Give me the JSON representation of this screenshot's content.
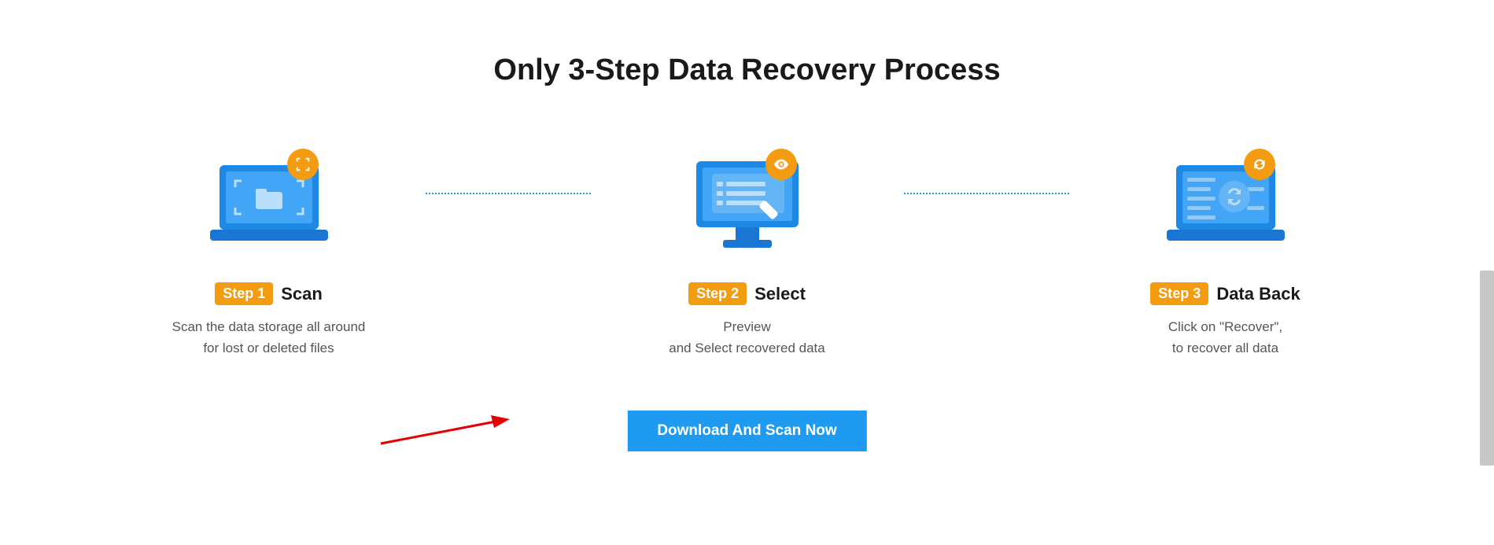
{
  "heading": "Only 3-Step Data Recovery Process",
  "steps": [
    {
      "pill": "Step 1",
      "title": "Scan",
      "desc": "Scan the data storage all around\nfor lost or deleted files",
      "badge_icon": "scan-icon"
    },
    {
      "pill": "Step 2",
      "title": "Select",
      "desc": "Preview\nand Select recovered data",
      "badge_icon": "eye-icon"
    },
    {
      "pill": "Step 3",
      "title": "Data Back",
      "desc": "Click on \"Recover\",\nto recover all data",
      "badge_icon": "refresh-icon"
    }
  ],
  "cta_label": "Download And Scan Now",
  "colors": {
    "accent_orange": "#f39c12",
    "accent_blue": "#1e9bf0",
    "arrow_red": "#e60000"
  }
}
